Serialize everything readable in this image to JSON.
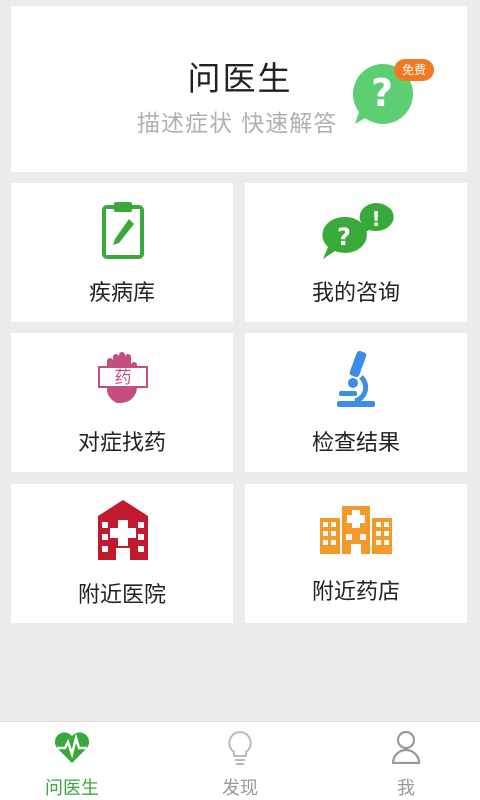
{
  "hero": {
    "title": "问医生",
    "subtitle": "描述症状 快速解答",
    "badge": "免费",
    "icon": "question-bubble-icon"
  },
  "tiles": [
    {
      "label": "疾病库",
      "icon": "clipboard-pen-icon"
    },
    {
      "label": "我的咨询",
      "icon": "chat-bubbles-icon"
    },
    {
      "label": "对症找药",
      "icon": "hand-medicine-icon"
    },
    {
      "label": "检查结果",
      "icon": "microscope-icon"
    },
    {
      "label": "附近医院",
      "icon": "hospital-icon"
    },
    {
      "label": "附近药店",
      "icon": "pharmacy-building-icon"
    }
  ],
  "tabbar": {
    "items": [
      {
        "label": "问医生",
        "icon": "heart-pulse-icon",
        "active": true
      },
      {
        "label": "发现",
        "icon": "lightbulb-icon",
        "active": false
      },
      {
        "label": "我",
        "icon": "user-icon",
        "active": false
      }
    ]
  },
  "colors": {
    "accent_green": "#39a93a",
    "hero_bubble": "#5ccf73",
    "badge_orange": "#f07a22",
    "medicine_pink": "#c64d80",
    "microscope_blue": "#3a8ee6",
    "hospital_red": "#c11a2f",
    "pharmacy_orange": "#f39a2a"
  }
}
